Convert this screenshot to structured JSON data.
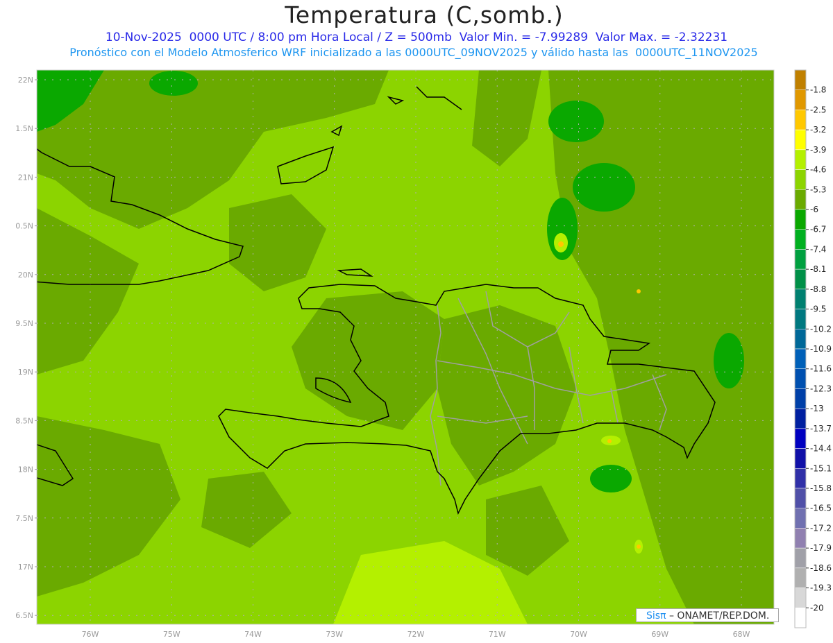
{
  "header": {
    "title": "Temperatura (C,somb.)",
    "line1": "10-Nov-2025  0000 UTC / 8:00 pm Hora Local / Z = 500mb  Valor Min. = -7.99289  Valor Max. = -2.32231",
    "line2": "Pronóstico con el Modelo Atmosferico WRF inicializado a las 0000UTC_09NOV2025 y válido hasta las  0000UTC_11NOV2025"
  },
  "map": {
    "variable": "Temperatura",
    "level": "500mb",
    "lat_labels": [
      "22N",
      "1.5N",
      "21N",
      "0.5N",
      "20N",
      "9.5N",
      "19N",
      "8.5N",
      "18N",
      "7.5N",
      "17N",
      "6.5N"
    ],
    "lon_labels": [
      "76W",
      "75W",
      "74W",
      "73W",
      "72W",
      "71W",
      "70W",
      "69W",
      "68W"
    ],
    "colors": {
      "light_green": "#8cd400",
      "olive_green": "#6aaa00",
      "green": "#0aa800",
      "coast": "#000000",
      "borders": "#a0a0a0",
      "grid": "#b0b0b0"
    }
  },
  "colorbar": {
    "labels": [
      "-1.8",
      "-2.5",
      "-3.2",
      "-3.9",
      "-4.6",
      "-5.3",
      "-6",
      "-6.7",
      "-7.4",
      "-8.1",
      "-8.8",
      "-9.5",
      "-10.2",
      "-10.9",
      "-11.6",
      "-12.3",
      "-13",
      "-13.7",
      "-14.4",
      "-15.1",
      "-15.8",
      "-16.5",
      "-17.2",
      "-17.9",
      "-18.6",
      "-19.3",
      "-20"
    ],
    "colors": [
      "#c08000",
      "#e09800",
      "#ffc800",
      "#ffff00",
      "#b4f000",
      "#8cd400",
      "#6aaa00",
      "#0aa800",
      "#00b020",
      "#00a040",
      "#009048",
      "#008070",
      "#007880",
      "#006898",
      "#0060b8",
      "#0050b0",
      "#0040a8",
      "#0020a0",
      "#0000c0",
      "#1010a8",
      "#3030a8",
      "#5050a8",
      "#7070b0",
      "#9080b0",
      "#a0a0a8",
      "#b0b0b0",
      "#d8d8d8",
      "#ffffff"
    ]
  },
  "credit": {
    "sis": "Sisπ",
    "rest": "– ONAMET/REP.DOM."
  }
}
